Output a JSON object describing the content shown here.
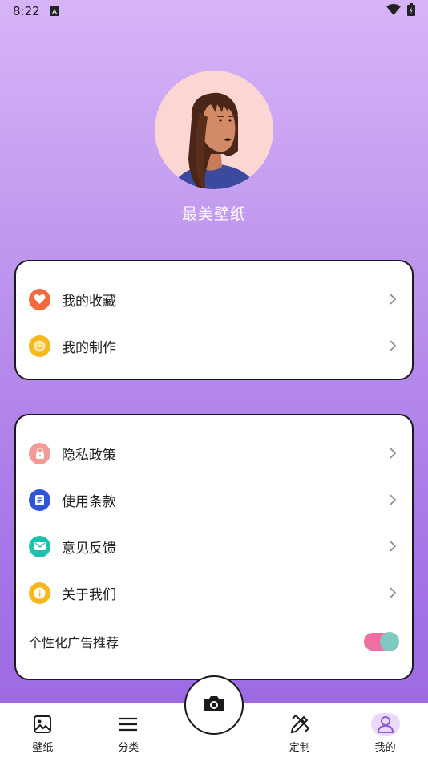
{
  "status_bar": {
    "time": "8:22"
  },
  "profile": {
    "name": "最美壁纸"
  },
  "menu_group_1": [
    {
      "label": "我的收藏",
      "icon": "heart-icon",
      "color": "#f26a3d"
    },
    {
      "label": "我的制作",
      "icon": "smile-icon",
      "color": "#f7b81c"
    }
  ],
  "menu_group_2": [
    {
      "label": "隐私政策",
      "icon": "lock-icon",
      "color": "#f29a95"
    },
    {
      "label": "使用条款",
      "icon": "document-icon",
      "color": "#2f56d6"
    },
    {
      "label": "意见反馈",
      "icon": "mail-icon",
      "color": "#1cc2b0"
    },
    {
      "label": "关于我们",
      "icon": "info-icon",
      "color": "#f7b81c"
    }
  ],
  "toggle": {
    "label": "个性化广告推荐",
    "enabled": true
  },
  "bottom_nav": {
    "items": [
      {
        "label": "壁纸",
        "icon": "image-icon"
      },
      {
        "label": "分类",
        "icon": "menu-icon"
      },
      {
        "label": "定制",
        "icon": "pencil-ruler-icon"
      },
      {
        "label": "我的",
        "icon": "user-icon",
        "active": true
      }
    ]
  },
  "colors": {
    "accent": "#9a66e2",
    "toggle_track": "#f06fa2",
    "toggle_knob": "#7fc9c3"
  }
}
